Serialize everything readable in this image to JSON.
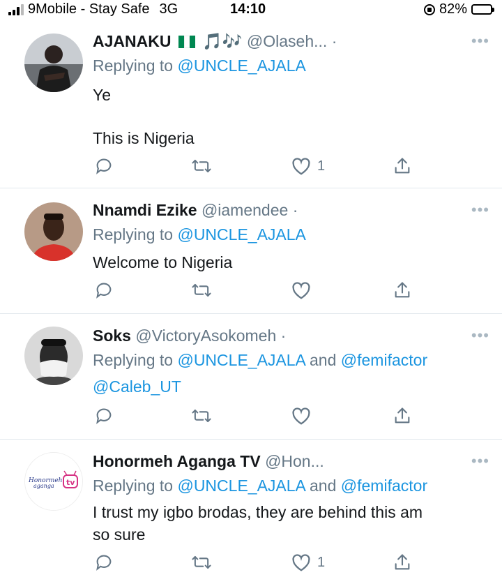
{
  "status_bar": {
    "carrier": "9Mobile - Stay Safe",
    "network": "3G",
    "time": "14:10",
    "battery": "82%",
    "battery_level": 0.82
  },
  "tweets": [
    {
      "name": "AJANAKU",
      "emoji": "🎵🎶",
      "handle": "@Olaseh...",
      "replying_prefix": "Replying to ",
      "replying_to": "@UNCLE_AJALA",
      "text_lines": [
        "Ye",
        "This is Nigeria"
      ],
      "like_count": "1"
    },
    {
      "name": "Nnamdi Ezike",
      "handle": "@iamendee",
      "replying_prefix": "Replying to ",
      "replying_to": "@UNCLE_AJALA",
      "text_lines": [
        "Welcome to Nigeria"
      ],
      "like_count": ""
    },
    {
      "name": "Soks",
      "handle": "@VictoryAsokomeh",
      "replying_prefix": "Replying to ",
      "replying_to": "@UNCLE_AJALA",
      "replying_and": " and ",
      "replying_to_2": "@femifactor",
      "replying_line2": "@Caleb_UT",
      "text_lines": [],
      "like_count": ""
    },
    {
      "name": "Honormeh Aganga TV",
      "handle": "@Hon...",
      "avatar_logo_text": "Honormeh aganga tv",
      "replying_prefix": "Replying to ",
      "replying_to": "@UNCLE_AJALA",
      "replying_and": " and ",
      "replying_to_2": "@femifactor",
      "text_lines": [
        "I trust my igbo brodas, they are behind this am",
        "so sure"
      ],
      "like_count": "1"
    }
  ],
  "icons": {
    "more": "more-icon",
    "reply": "reply-icon",
    "retweet": "retweet-icon",
    "like": "heart-icon",
    "share": "share-icon"
  },
  "colors": {
    "link": "#1b95e0",
    "secondary_text": "#657786",
    "nigeria_green": "#008751"
  }
}
